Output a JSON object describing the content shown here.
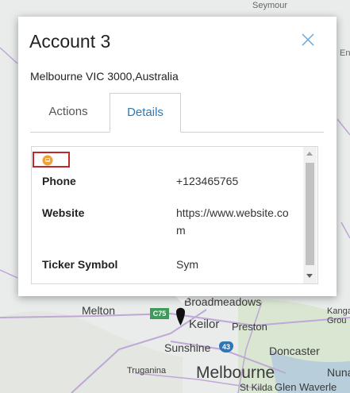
{
  "map": {
    "labels": {
      "top": "Seymour",
      "top_right": "En",
      "melton": "Melton",
      "highway": "C75",
      "broadmeadows": "Broadmeadows",
      "keilor": "Keilor",
      "preston": "Preston",
      "kangaroo_ground": "Kanga\nGrou",
      "sunshine": "Sunshine",
      "route43": "43",
      "doncaster": "Doncaster",
      "truganina": "Truganina",
      "melbourne": "Melbourne",
      "nunawading": "Nuna",
      "st_kilda": "St Kilda",
      "glen_waverley": "Glen Waverle"
    },
    "colors": {
      "background": "#e9ecea",
      "roads": "#bfa7d6",
      "water": "#aac4de",
      "green": "#cfe2c1",
      "shield_green": "#3f9b5a",
      "shield_blue": "#2f76b7",
      "pin": "#111111"
    }
  },
  "popup": {
    "title": "Account 3",
    "address": "Melbourne VIC 3000,Australia",
    "tabs": [
      {
        "label": "Actions",
        "active": false
      },
      {
        "label": "Details",
        "active": true
      }
    ],
    "accent_color": "#2a7ab8",
    "details": {
      "icon": "account-avatar-icon",
      "fields": [
        {
          "label": "Phone",
          "value": "+123465765"
        },
        {
          "label": "Website",
          "value": "https://www.website.com"
        },
        {
          "label": "Ticker Symbol",
          "value": "Sym"
        }
      ]
    }
  }
}
